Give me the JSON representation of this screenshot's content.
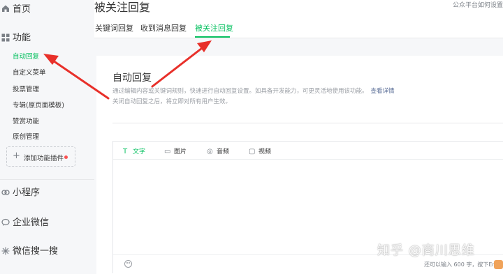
{
  "sidebar": {
    "home_label": "首页",
    "section_label": "功能",
    "items": [
      {
        "label": "自动回复",
        "active": true
      },
      {
        "label": "自定义菜单"
      },
      {
        "label": "投票管理"
      },
      {
        "label": "专辑(原页面模板)"
      },
      {
        "label": "赞赏功能"
      },
      {
        "label": "原创管理"
      }
    ],
    "add_plugin_label": "添加功能插件",
    "groups": [
      {
        "label": "小程序",
        "icon": "mini-program-icon"
      },
      {
        "label": "企业微信",
        "icon": "wecom-icon"
      },
      {
        "label": "微信搜一搜",
        "icon": "search-sparkle-icon"
      }
    ]
  },
  "header": {
    "title": "被关注回复",
    "settings_link": "公众平台如何设置"
  },
  "tabs": [
    {
      "label": "关键词回复"
    },
    {
      "label": "收到消息回复"
    },
    {
      "label": "被关注回复",
      "active": true
    }
  ],
  "panel": {
    "title": "自动回复",
    "description": "通过编辑内容或关键词规则，快速进行自动回复设置。如具备开发能力，可更灵活地使用该功能。",
    "more_link": "查看详情",
    "note": "关闭自动回复之后，将立即对所有用户生效。"
  },
  "editor": {
    "tabs": [
      {
        "label": "文字",
        "icon": "text-icon",
        "glyph": "T",
        "active": true
      },
      {
        "label": "图片",
        "icon": "image-icon",
        "glyph": "▭"
      },
      {
        "label": "音频",
        "icon": "audio-icon",
        "glyph": "◎"
      },
      {
        "label": "视频",
        "icon": "video-icon",
        "glyph": "▢"
      }
    ],
    "char_count": "还可以输入 600 字，按下En"
  },
  "watermark": "知乎 @商川思维",
  "colors": {
    "accent": "#07c160",
    "annotation": "#e8302a",
    "link": "#576b95",
    "sidebar_bg": "#f6f7f9"
  }
}
